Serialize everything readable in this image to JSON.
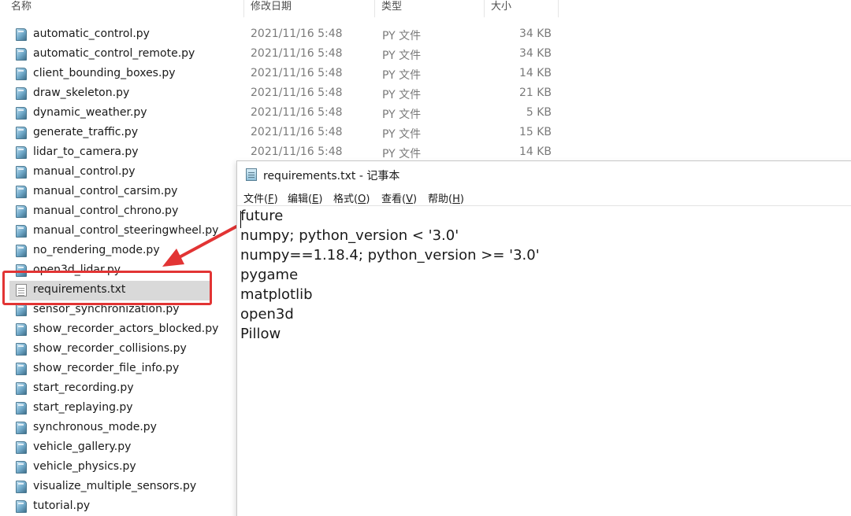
{
  "explorer": {
    "columns": {
      "name": "名称",
      "date": "修改日期",
      "type": "类型",
      "size": "大小"
    },
    "files": [
      {
        "name": "automatic_control.py",
        "date": "2021/11/16 5:48",
        "type": "PY 文件",
        "size": "34 KB",
        "icon": "python-file-icon"
      },
      {
        "name": "automatic_control_remote.py",
        "date": "2021/11/16 5:48",
        "type": "PY 文件",
        "size": "34 KB",
        "icon": "python-file-icon"
      },
      {
        "name": "client_bounding_boxes.py",
        "date": "2021/11/16 5:48",
        "type": "PY 文件",
        "size": "14 KB",
        "icon": "python-file-icon"
      },
      {
        "name": "draw_skeleton.py",
        "date": "2021/11/16 5:48",
        "type": "PY 文件",
        "size": "21 KB",
        "icon": "python-file-icon"
      },
      {
        "name": "dynamic_weather.py",
        "date": "2021/11/16 5:48",
        "type": "PY 文件",
        "size": "5 KB",
        "icon": "python-file-icon"
      },
      {
        "name": "generate_traffic.py",
        "date": "2021/11/16 5:48",
        "type": "PY 文件",
        "size": "15 KB",
        "icon": "python-file-icon"
      },
      {
        "name": "lidar_to_camera.py",
        "date": "2021/11/16 5:48",
        "type": "PY 文件",
        "size": "14 KB",
        "icon": "python-file-icon"
      },
      {
        "name": "manual_control.py",
        "icon": "python-file-icon"
      },
      {
        "name": "manual_control_carsim.py",
        "icon": "python-file-icon"
      },
      {
        "name": "manual_control_chrono.py",
        "icon": "python-file-icon"
      },
      {
        "name": "manual_control_steeringwheel.py",
        "icon": "python-file-icon"
      },
      {
        "name": "no_rendering_mode.py",
        "icon": "python-file-icon"
      },
      {
        "name": "open3d_lidar.py",
        "icon": "python-file-icon"
      },
      {
        "name": "requirements.txt",
        "icon": "text-file-icon",
        "selected": true
      },
      {
        "name": "sensor_synchronization.py",
        "icon": "python-file-icon"
      },
      {
        "name": "show_recorder_actors_blocked.py",
        "icon": "python-file-icon"
      },
      {
        "name": "show_recorder_collisions.py",
        "icon": "python-file-icon"
      },
      {
        "name": "show_recorder_file_info.py",
        "icon": "python-file-icon"
      },
      {
        "name": "start_recording.py",
        "icon": "python-file-icon"
      },
      {
        "name": "start_replaying.py",
        "icon": "python-file-icon"
      },
      {
        "name": "synchronous_mode.py",
        "icon": "python-file-icon"
      },
      {
        "name": "vehicle_gallery.py",
        "icon": "python-file-icon"
      },
      {
        "name": "vehicle_physics.py",
        "icon": "python-file-icon"
      },
      {
        "name": "visualize_multiple_sensors.py",
        "icon": "python-file-icon"
      },
      {
        "name": "tutorial.py",
        "icon": "python-file-icon"
      }
    ]
  },
  "annotation": {
    "color": "#e23434"
  },
  "notepad": {
    "title": "requirements.txt - 记事本",
    "menu": [
      {
        "label": "文件",
        "key": "F"
      },
      {
        "label": "编辑",
        "key": "E"
      },
      {
        "label": "格式",
        "key": "O"
      },
      {
        "label": "查看",
        "key": "V"
      },
      {
        "label": "帮助",
        "key": "H"
      }
    ],
    "lines": [
      "future",
      "numpy; python_version < '3.0'",
      "numpy==1.18.4; python_version >= '3.0'",
      "pygame",
      "matplotlib",
      "open3d",
      "Pillow"
    ]
  }
}
